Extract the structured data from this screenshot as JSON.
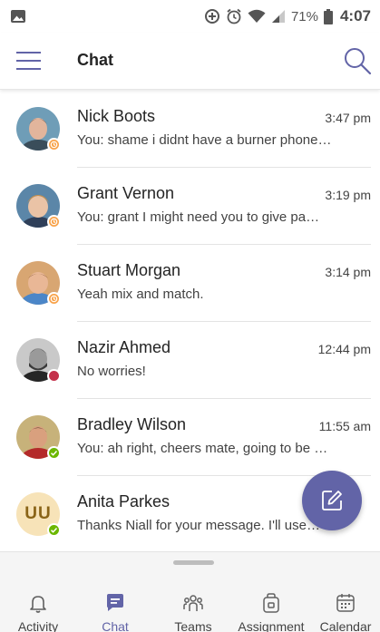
{
  "status_bar": {
    "battery": "71%",
    "time": "4:07"
  },
  "header": {
    "title": "Chat"
  },
  "chats": [
    {
      "name": "Nick Boots",
      "time": "3:47 pm",
      "preview": "You: shame i didnt have a burner phone…",
      "presence": "away"
    },
    {
      "name": "Grant Vernon",
      "time": "3:19 pm",
      "preview": "You: grant I might need you to give pa…",
      "presence": "away"
    },
    {
      "name": "Stuart Morgan",
      "time": "3:14 pm",
      "preview": "Yeah mix and match.",
      "presence": "away"
    },
    {
      "name": "Nazir Ahmed",
      "time": "12:44 pm",
      "preview": "No worries!",
      "presence": "busy"
    },
    {
      "name": "Bradley Wilson",
      "time": "11:55 am",
      "preview": "You: ah right, cheers mate, going to be …",
      "presence": "available"
    },
    {
      "name": "Anita Parkes",
      "initials": "UU",
      "time": "",
      "preview": "Thanks Niall for your message. I'll use…",
      "presence": "available"
    }
  ],
  "bottom_nav": [
    {
      "label": "Activity",
      "icon": "bell-icon"
    },
    {
      "label": "Chat",
      "icon": "chat-icon",
      "active": true
    },
    {
      "label": "Teams",
      "icon": "teams-icon"
    },
    {
      "label": "Assignment",
      "icon": "assignment-icon"
    },
    {
      "label": "Calendar",
      "icon": "calendar-icon"
    }
  ],
  "colors": {
    "accent": "#6264a7",
    "away": "#f8a34b",
    "busy": "#c4314b",
    "available": "#6bb700"
  }
}
